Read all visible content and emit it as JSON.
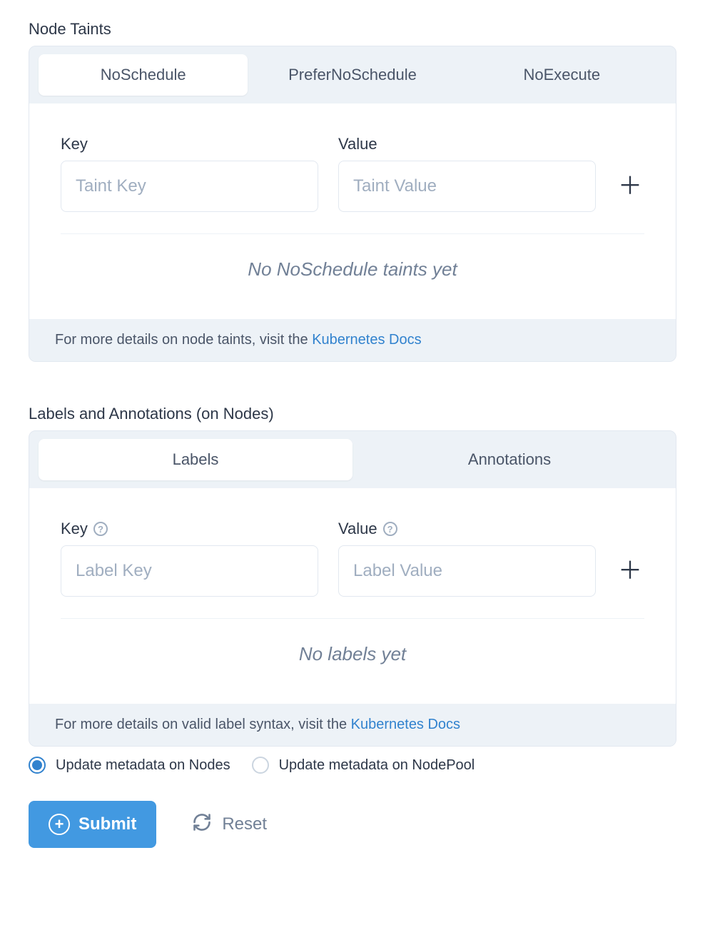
{
  "taints": {
    "title": "Node Taints",
    "tabs": [
      "NoSchedule",
      "PreferNoSchedule",
      "NoExecute"
    ],
    "active_tab": 0,
    "key_label": "Key",
    "value_label": "Value",
    "key_placeholder": "Taint Key",
    "value_placeholder": "Taint Value",
    "empty_message": "No NoSchedule taints yet",
    "footer_text": "For more details on node taints, visit the ",
    "footer_link": "Kubernetes Docs"
  },
  "labels": {
    "title": "Labels and Annotations (on Nodes)",
    "tabs": [
      "Labels",
      "Annotations"
    ],
    "active_tab": 0,
    "key_label": "Key",
    "value_label": "Value",
    "key_placeholder": "Label Key",
    "value_placeholder": "Label Value",
    "empty_message": "No labels yet",
    "footer_text": "For more details on valid label syntax, visit the ",
    "footer_link": "Kubernetes Docs"
  },
  "radios": {
    "option_nodes": "Update metadata on Nodes",
    "option_nodepool": "Update metadata on NodePool",
    "selected": "nodes"
  },
  "actions": {
    "submit": "Submit",
    "reset": "Reset"
  }
}
